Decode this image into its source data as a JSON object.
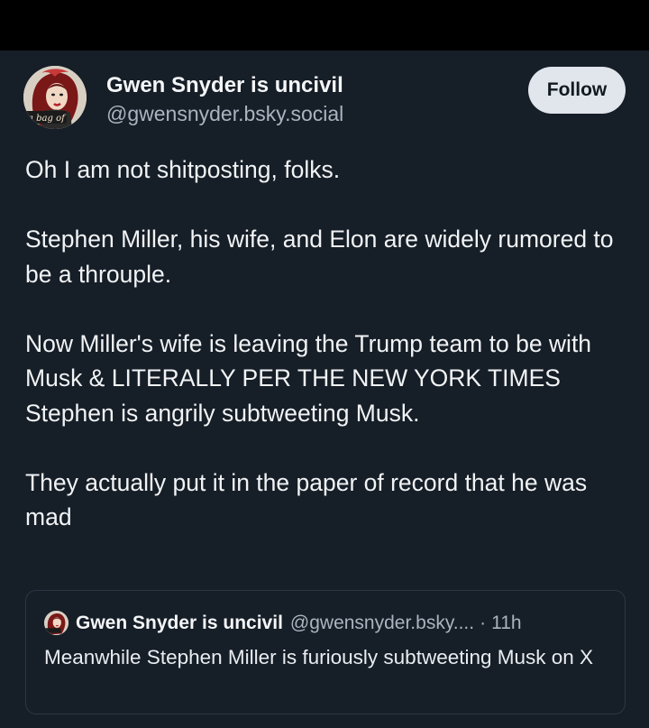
{
  "post": {
    "author_name": "Gwen Snyder is uncivil",
    "author_handle": "@gwensnyder.bsky.social",
    "avatar_text": "a bag of",
    "follow_label": "Follow",
    "paragraphs": [
      "Oh I am not shitposting, folks.",
      "Stephen Miller, his wife, and Elon are widely rumored to be a throuple.",
      "Now Miller's wife is leaving the Trump team to be with Musk & LITERALLY PER THE NEW YORK TIMES Stephen is angrily subtweeting Musk.",
      "They actually put it in the paper of record that he was mad"
    ]
  },
  "quote": {
    "author_name": "Gwen Snyder is uncivil",
    "author_handle": "@gwensnyder.bsky....",
    "separator": "·",
    "time": "11h",
    "text": "Meanwhile Stephen Miller is furiously subtweeting Musk on X"
  },
  "colors": {
    "background": "#161e27",
    "top_bar": "#000000",
    "follow_button": "#e1e6ec",
    "secondary_text": "#aab4c0"
  }
}
